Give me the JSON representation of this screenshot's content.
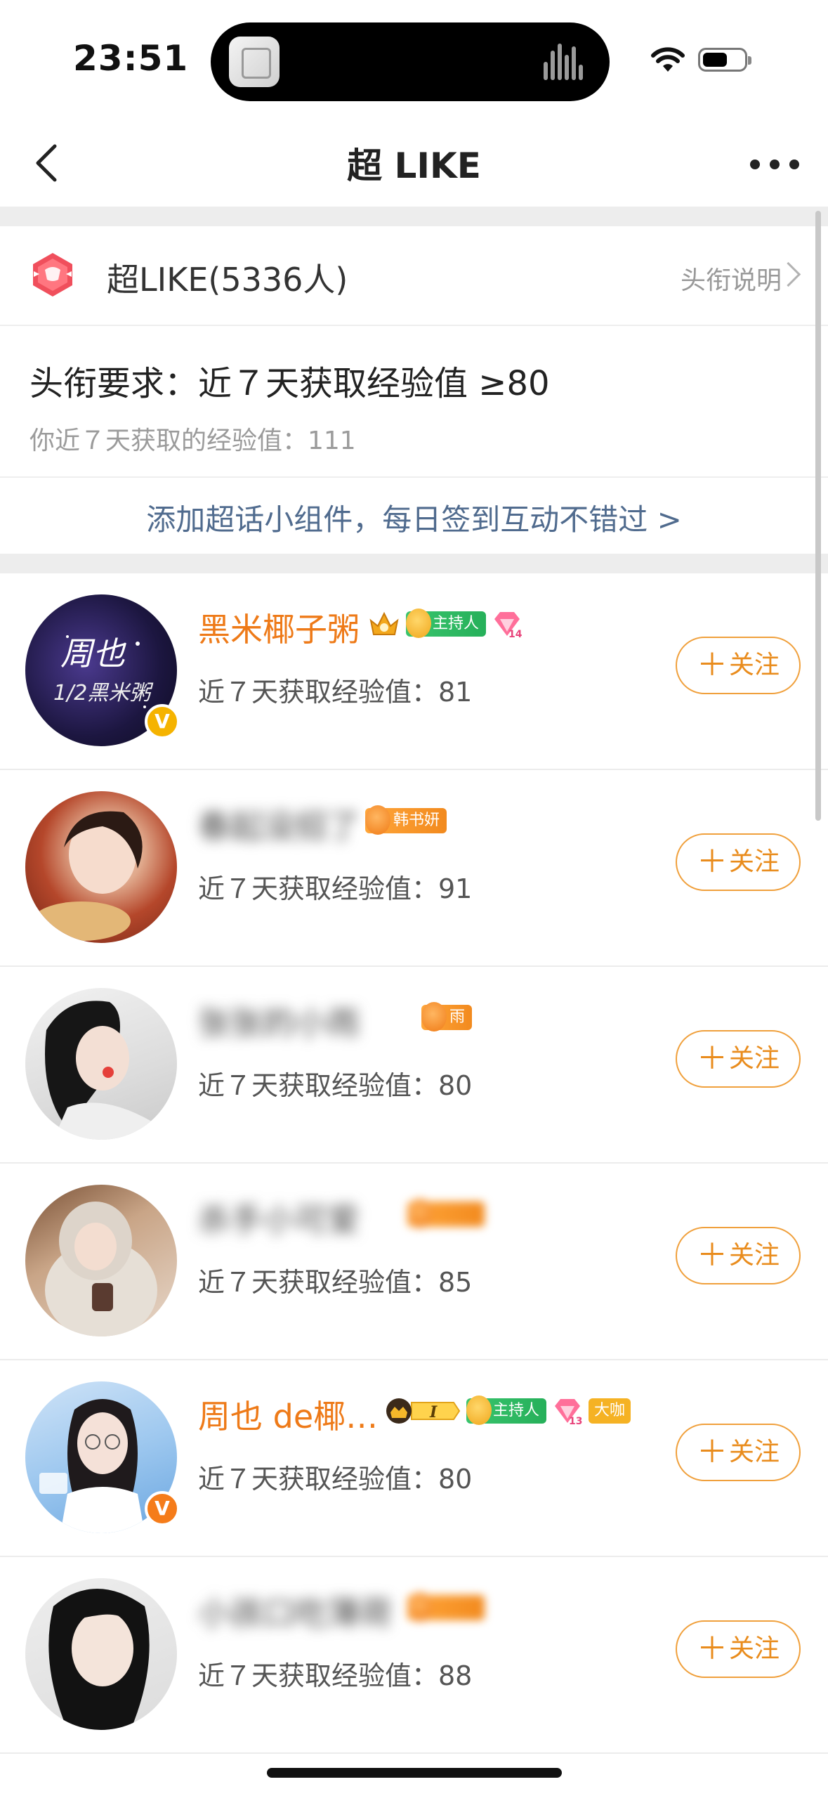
{
  "status_bar": {
    "time": "23:51"
  },
  "nav": {
    "title": "超 LIKE"
  },
  "header": {
    "title": "超LIKE(5336人)",
    "link": "头衔说明",
    "requirement": "头衔要求：近７天获取经验值 ≥80",
    "my_exp": "你近７天获取的经验值：111",
    "widget_prompt": "添加超话小组件，每日签到互动不错过 >"
  },
  "follow_label": "关注",
  "follow_plus": "＋",
  "users": [
    {
      "name": "黑米椰子粥",
      "stat": "近７天获取经验值：81",
      "verified": true,
      "badge_color": "#f5b300",
      "chip": "主持人",
      "gem_level": "14"
    },
    {
      "name": "春起没招了",
      "stat": "近７天获取经验值：91",
      "chip": "韩书妍"
    },
    {
      "name": "张张的小雨",
      "stat": "近７天获取经验值：80",
      "chip": "雨"
    },
    {
      "name": "杀手小可爱",
      "stat": "近７天获取经验值：85"
    },
    {
      "name": "周也 de椰…",
      "stat": "近７天获取经验值：80",
      "verified": true,
      "badge_color": "#f57c1a",
      "level_mark": "I",
      "chip": "主持人",
      "gem_level": "13",
      "tag": "大咖"
    },
    {
      "name": "小孩口吃薄荷",
      "stat": "近７天获取经验值：88"
    }
  ]
}
